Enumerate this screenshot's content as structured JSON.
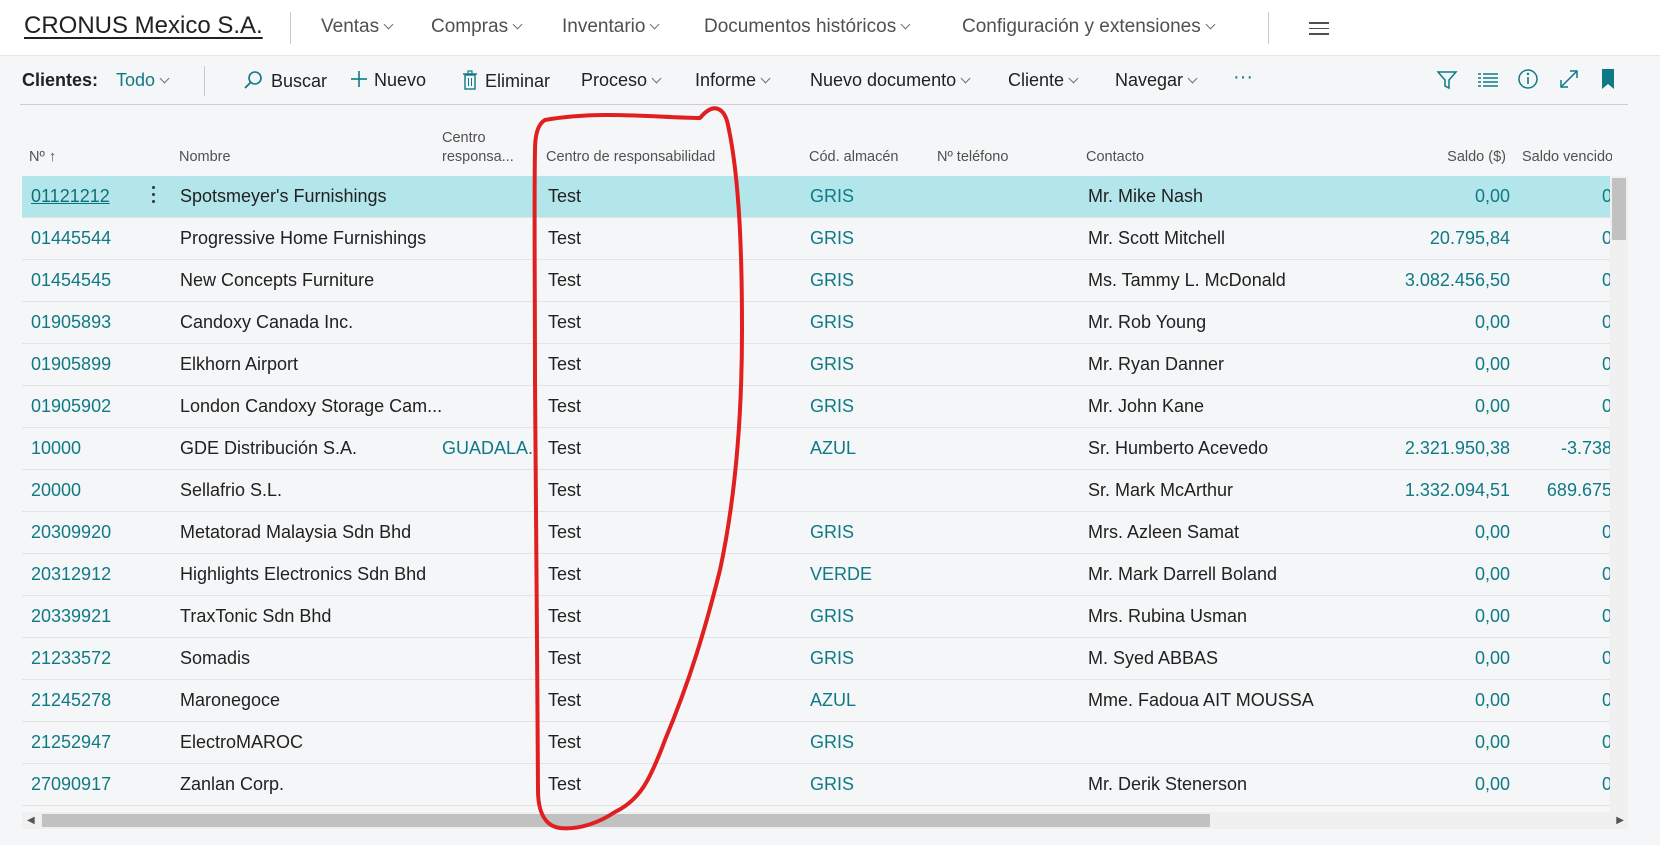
{
  "company": "CRONUS Mexico S.A.",
  "nav": [
    "Ventas",
    "Compras",
    "Inventario",
    "Documentos históricos",
    "Configuración y extensiones"
  ],
  "actions": {
    "page_label": "Clientes:",
    "filter_value": "Todo",
    "search": "Buscar",
    "new": "Nuevo",
    "delete": "Eliminar",
    "process": "Proceso",
    "report": "Informe",
    "new_document": "Nuevo documento",
    "customer": "Cliente",
    "navigate": "Navegar",
    "more": "···"
  },
  "columns": {
    "no": "Nº",
    "name": "Nombre",
    "resp_short_1": "Centro",
    "resp_short_2": "responsa...",
    "resp": "Centro de responsabilidad",
    "location": "Cód. almacén",
    "phone": "Nº teléfono",
    "contact": "Contacto",
    "balance": "Saldo ($)",
    "overdue": "Saldo vencido ($"
  },
  "rows": [
    {
      "no": "01121212",
      "name": "Spotsmeyer's Furnishings",
      "resp_short": "",
      "resp": "Test",
      "location": "GRIS",
      "phone": "",
      "contact": "Mr. Mike Nash",
      "balance": "0,00",
      "overdue": "0"
    },
    {
      "no": "01445544",
      "name": "Progressive Home Furnishings",
      "resp_short": "",
      "resp": "Test",
      "location": "GRIS",
      "phone": "",
      "contact": "Mr. Scott Mitchell",
      "balance": "20.795,84",
      "overdue": "0"
    },
    {
      "no": "01454545",
      "name": "New Concepts Furniture",
      "resp_short": "",
      "resp": "Test",
      "location": "GRIS",
      "phone": "",
      "contact": "Ms. Tammy L. McDonald",
      "balance": "3.082.456,50",
      "overdue": "0"
    },
    {
      "no": "01905893",
      "name": "Candoxy Canada Inc.",
      "resp_short": "",
      "resp": "Test",
      "location": "GRIS",
      "phone": "",
      "contact": "Mr. Rob Young",
      "balance": "0,00",
      "overdue": "0"
    },
    {
      "no": "01905899",
      "name": "Elkhorn Airport",
      "resp_short": "",
      "resp": "Test",
      "location": "GRIS",
      "phone": "",
      "contact": "Mr. Ryan Danner",
      "balance": "0,00",
      "overdue": "0"
    },
    {
      "no": "01905902",
      "name": "London Candoxy Storage Cam...",
      "resp_short": "",
      "resp": "Test",
      "location": "GRIS",
      "phone": "",
      "contact": "Mr. John Kane",
      "balance": "0,00",
      "overdue": "0"
    },
    {
      "no": "10000",
      "name": "GDE Distribución S.A.",
      "resp_short": "GUADALA...",
      "resp": "Test",
      "location": "AZUL",
      "phone": "",
      "contact": "Sr. Humberto Acevedo",
      "balance": "2.321.950,38",
      "overdue": "-3.738"
    },
    {
      "no": "20000",
      "name": "Sellafrio S.L.",
      "resp_short": "",
      "resp": "Test",
      "location": "",
      "phone": "",
      "contact": "Sr. Mark McArthur",
      "balance": "1.332.094,51",
      "overdue": "689.675"
    },
    {
      "no": "20309920",
      "name": "Metatorad Malaysia Sdn Bhd",
      "resp_short": "",
      "resp": "Test",
      "location": "GRIS",
      "phone": "",
      "contact": "Mrs. Azleen Samat",
      "balance": "0,00",
      "overdue": "0"
    },
    {
      "no": "20312912",
      "name": "Highlights Electronics Sdn Bhd",
      "resp_short": "",
      "resp": "Test",
      "location": "VERDE",
      "phone": "",
      "contact": "Mr. Mark Darrell Boland",
      "balance": "0,00",
      "overdue": "0"
    },
    {
      "no": "20339921",
      "name": "TraxTonic Sdn Bhd",
      "resp_short": "",
      "resp": "Test",
      "location": "GRIS",
      "phone": "",
      "contact": "Mrs. Rubina Usman",
      "balance": "0,00",
      "overdue": "0"
    },
    {
      "no": "21233572",
      "name": "Somadis",
      "resp_short": "",
      "resp": "Test",
      "location": "GRIS",
      "phone": "",
      "contact": "M. Syed ABBAS",
      "balance": "0,00",
      "overdue": "0"
    },
    {
      "no": "21245278",
      "name": "Maronegoce",
      "resp_short": "",
      "resp": "Test",
      "location": "AZUL",
      "phone": "",
      "contact": "Mme. Fadoua AIT MOUSSA",
      "balance": "0,00",
      "overdue": "0"
    },
    {
      "no": "21252947",
      "name": "ElectroMAROC",
      "resp_short": "",
      "resp": "Test",
      "location": "GRIS",
      "phone": "",
      "contact": "",
      "balance": "0,00",
      "overdue": "0"
    },
    {
      "no": "27090917",
      "name": "Zanlan Corp.",
      "resp_short": "",
      "resp": "Test",
      "location": "GRIS",
      "phone": "",
      "contact": "Mr. Derik Stenerson",
      "balance": "0,00",
      "overdue": "0"
    }
  ],
  "colors": {
    "accent": "#0f7a85",
    "selected_row": "#b3e6eb",
    "annotation": "#e02020"
  }
}
